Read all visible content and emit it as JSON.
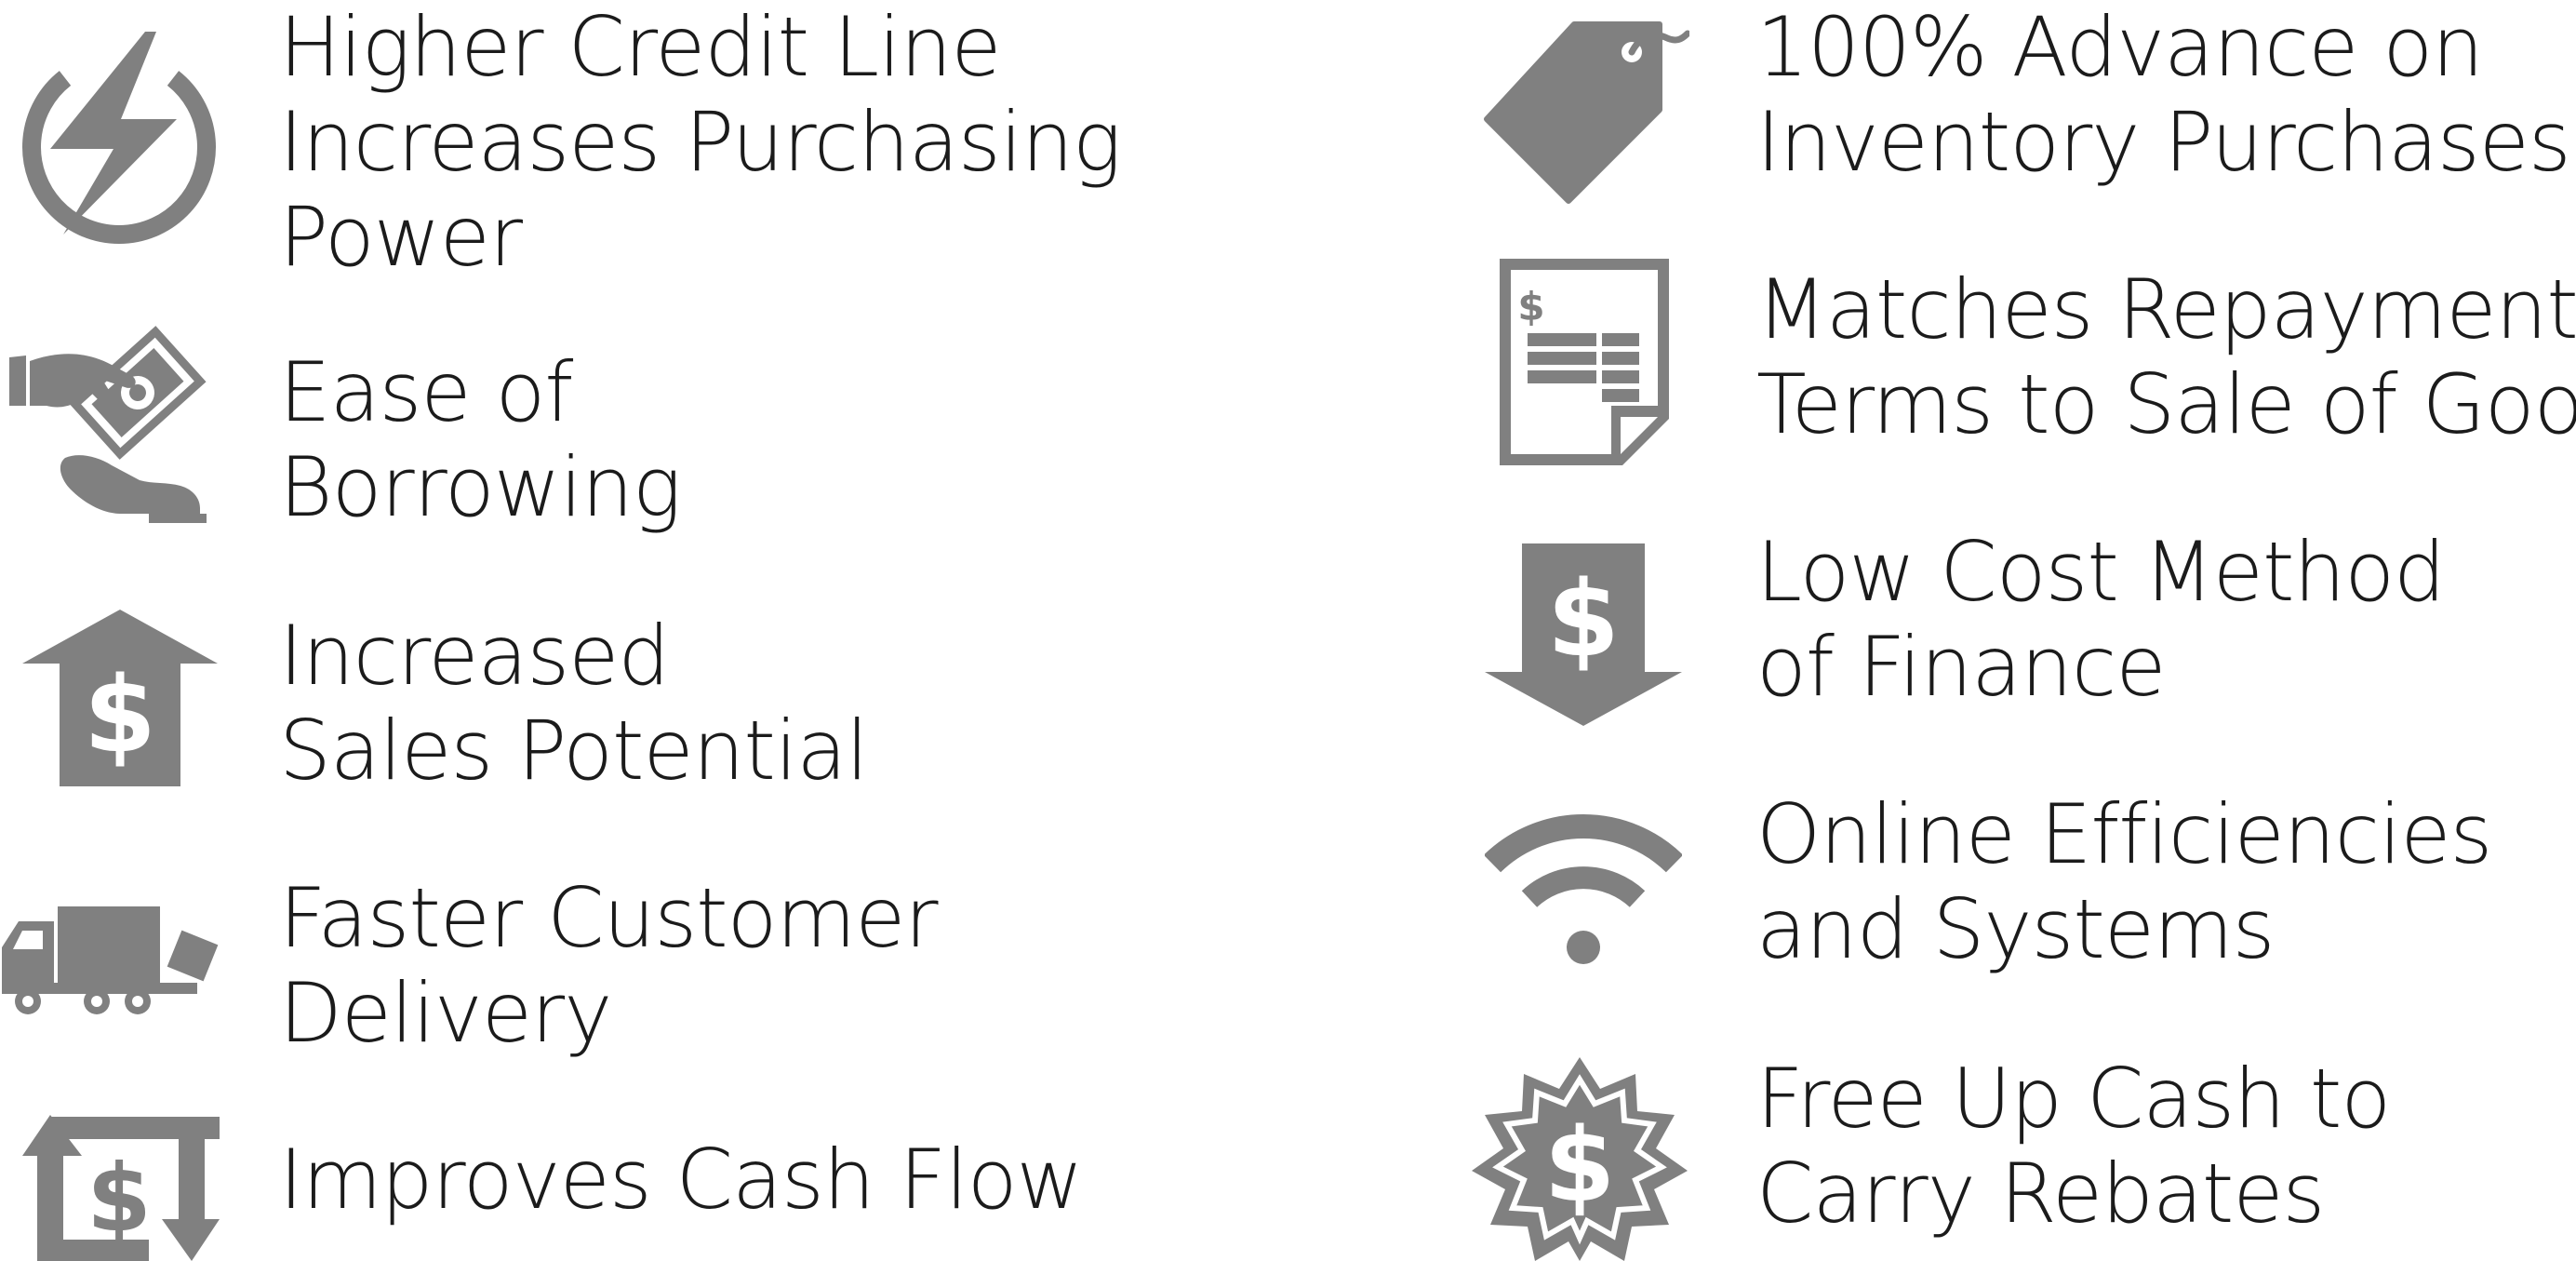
{
  "icon_color": "#808080",
  "benefits": [
    {
      "icon": "lightning-bolt-icon",
      "lines": [
        "Higher Credit Line",
        "Increases Purchasing",
        "Power"
      ]
    },
    {
      "icon": "hand-money-icon",
      "lines": [
        "Ease of",
        "Borrowing"
      ]
    },
    {
      "icon": "dollar-arrow-up-icon",
      "lines": [
        "Increased",
        "Sales Potential"
      ]
    },
    {
      "icon": "delivery-truck-icon",
      "lines": [
        "Faster Customer",
        "Delivery"
      ]
    },
    {
      "icon": "cash-cycle-icon",
      "lines": [
        "Improves Cash Flow"
      ]
    },
    {
      "icon": "price-tag-icon",
      "lines": [
        "100% Advance on",
        "Inventory Purchases"
      ]
    },
    {
      "icon": "invoice-document-icon",
      "lines": [
        "Matches Repayment",
        "Terms to Sale of Goods"
      ]
    },
    {
      "icon": "dollar-arrow-down-icon",
      "lines": [
        "Low Cost Method",
        "of Finance"
      ]
    },
    {
      "icon": "wifi-icon",
      "lines": [
        "Online Efficiencies",
        "and Systems"
      ]
    },
    {
      "icon": "dollar-seal-icon",
      "lines": [
        "Free Up Cash to",
        "Carry Rebates"
      ]
    }
  ]
}
